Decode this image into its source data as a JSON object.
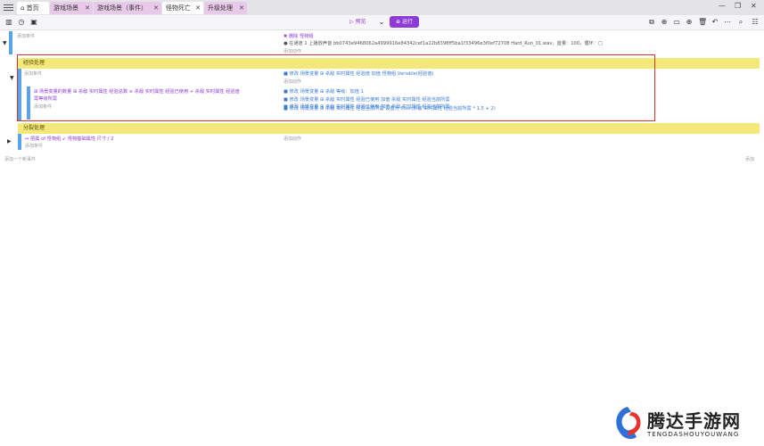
{
  "tabs": [
    {
      "label": "首页"
    },
    {
      "label": "游戏场景"
    },
    {
      "label": "游戏场景（事件）"
    },
    {
      "label": "怪物死亡"
    },
    {
      "label": "升级处理"
    }
  ],
  "toolbar": {
    "preview": "▷ 预览",
    "run": "⊕ 运行"
  },
  "events": {
    "add_condition_1": "添加条件",
    "action_title": "✖ 删除 怪物组",
    "action_detail": "● 在通道 1 上播放声音 bb0743e9468062a4999916e84342cef1a22b8398ff5ba1f33496e3f0ef72708 Hard_Run_01.wav，音量：100，循环：□",
    "add_action_1": "添加动作",
    "section_exp": "经验处理",
    "add_condition_2": "添加条件",
    "exp_actions": [
      "■ 修改 场景变量 ⊞ 杀敌 实时属性 经验值 加值 怪物组.Variable(经验值)",
      "添加动作"
    ],
    "sub_condition": "⊞ 场景变量的数量 ⊞ 杀敌 实时属性 经验总数 ≥ 杀敌 实时属性 经验已使用 + 杀敌 实时属性 经验值",
    "sub_condition_2": "需等级所需",
    "add_condition_3": "添加条件",
    "sub_actions": [
      "■ 修改 场景变量 ⊞ 杀敌 等级：加值 1",
      "■ 修改 场景变量 ⊞ 杀敌 实时属性 经验已使用 加值 杀敌 实时属性 经验当前所需",
      "■ 修改 场景变量 ⊞ 杀敌 实时属性 经验已使用 加值 杀敌 实时属性 经验当前所需",
      "■ 修改 场景变量 ⊞ 杀敌 实时属性 经验当前所需 设置为 floor(杀敌 实时属性 经验当前所需 * 1.5 + 2)"
    ],
    "section_split": "分裂处理",
    "split_condition": "↔ 把属 of 怪物组 ↙ 怪物基础属性 尺寸 / 2",
    "add_action_2": "添加动作",
    "add_condition_4": "添加条件",
    "add_event": "添加一个新事件",
    "right_add": "添加"
  },
  "watermark": {
    "title": "腾达手游网",
    "subtitle": "TENGDASHOUYOUWANG"
  }
}
